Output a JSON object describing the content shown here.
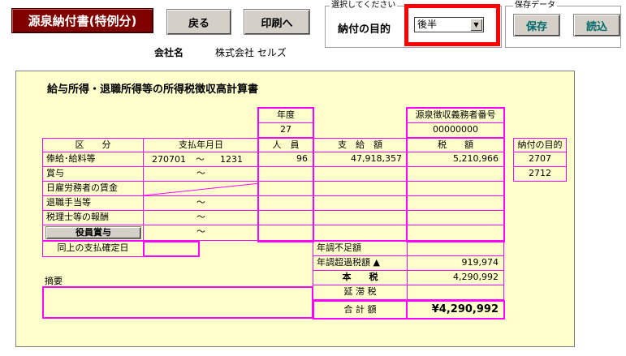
{
  "header": {
    "title_button": "源泉納付書(特例分)",
    "back_button": "戻る",
    "print_button": "印刷へ",
    "select_group_label": "選択してください",
    "purpose_label": "納付の目的",
    "purpose_value": "後半",
    "save_group_label": "保存データ",
    "save_button": "保存",
    "load_button": "読込",
    "company_label": "会社名",
    "company_name": "株式会社 セルズ"
  },
  "panel": {
    "title": "給与所得・退職所得等の所得税徴収高計算書",
    "year_label": "年度",
    "year_value": "27",
    "obligor_label": "源泉徴収義務者番号",
    "obligor_value": "00000000",
    "columns": {
      "category": "区　　分",
      "pay_date": "支払年月日",
      "persons": "人　員",
      "amount": "支　給　額",
      "tax": "税　　額"
    },
    "rows": [
      {
        "label": "俸給･給料等",
        "from": "270701",
        "sep": "～",
        "to": "1231",
        "persons": "96",
        "amount": "47,918,357",
        "tax": "5,210,966"
      },
      {
        "label": "賞与",
        "sep": "～"
      },
      {
        "label": "日雇労務者の賃金"
      },
      {
        "label": "退職手当等",
        "sep": "～"
      },
      {
        "label": "税理士等の報酬",
        "sep": "～"
      },
      {
        "label": "役員賞与",
        "sep": "～"
      }
    ],
    "confirm_label": "同上の支払確定日",
    "shortage_label": "年調不足額",
    "excess_label": "年調超過税額 ▲",
    "excess_value": "919,974",
    "main_tax_label": "本　　税",
    "main_tax_value": "4,290,992",
    "late_tax_label": "延 滞 税",
    "total_label": "合 計 額",
    "total_value": "¥4,290,992",
    "remarks_label": "摘要",
    "purpose_table_label": "納付の目的",
    "purpose_codes": [
      "2707",
      "2712"
    ]
  },
  "colors": {
    "highlight": "#ff0000",
    "grid": "#ff00ff",
    "panel_bg": "#ffffcc",
    "title_bg": "#800000"
  }
}
